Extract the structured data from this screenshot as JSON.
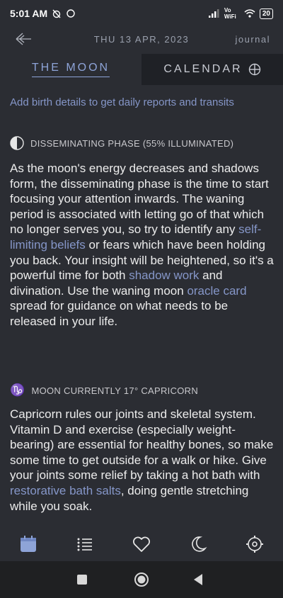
{
  "status_bar": {
    "time": "5:01 AM",
    "network": "Vo WiFi",
    "battery": "20"
  },
  "header": {
    "date": "THU 13 APR, 2023",
    "journal_label": "journal"
  },
  "tabs": [
    {
      "label": "THE MOON",
      "active": true
    },
    {
      "label": "CALENDAR",
      "active": false
    }
  ],
  "birth_link": "Add birth details to get daily reports and transits",
  "phase": {
    "heading": "DISSEMINATING PHASE (55% ILLUMINATED)",
    "text_1": "As the moon's energy decreases and shadows form, the disseminating phase is the time to start focusing your attention inwards. The waning period is associated with letting go of that which no longer serves you, so try to identify any ",
    "link_1": "self-limiting beliefs",
    "text_2": " or fears which have been holding you back. Your insight will be heightened, so it's a powerful time for both ",
    "link_2": "shadow work",
    "text_3": " and divination. Use the waning moon ",
    "link_3": "oracle card",
    "text_4": " spread for guidance on what needs to be released in your life."
  },
  "sign": {
    "heading": "MOON CURRENTLY 17° CAPRICORN",
    "text_1": "Capricorn rules our joints and skeletal system. Vitamin D and exercise (especially weight-bearing) are essential for healthy bones, so make some time to get outside for a walk or hike. Give your joints some relief by taking a hot bath with ",
    "link_1": "restorative bath salts",
    "text_2": ", doing gentle stretching while you soak."
  },
  "colors": {
    "accent": "#8596c8",
    "background": "#2b2d33",
    "text": "#ececec"
  },
  "icons": [
    "back-arrow-icon",
    "globe-plus-icon",
    "half-moon-icon",
    "capricorn-icon",
    "calendar-icon",
    "list-icon",
    "heart-icon",
    "crescent-moon-icon",
    "settings-icon"
  ]
}
